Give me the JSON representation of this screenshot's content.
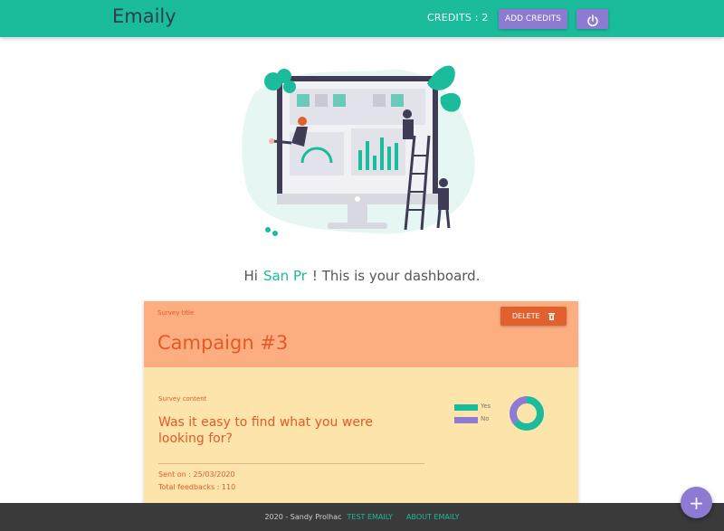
{
  "navbar": {
    "brand": "Emaily",
    "credits": "CREDITS : 2",
    "add_credits_label": "ADD CREDITS",
    "logout_icon": "power-icon"
  },
  "greeting": {
    "prefix": "Hi",
    "user_name": "San Pr",
    "suffix": "! This is your dashboard."
  },
  "survey": {
    "title_label": "Survey title",
    "title": "Campaign #3",
    "delete_label": "DELETE",
    "delete_icon": "trash-icon",
    "content_label": "Survey content",
    "question": "Was it easy to find what you were looking for?",
    "sent_on": "Sent on : 25/03/2020",
    "total_feedbacks": "Total feedbacks : 110",
    "chart_data": {
      "type": "pie",
      "categories": [
        "Yes",
        "No"
      ],
      "values": [
        0.64,
        0.36
      ],
      "colors": [
        "#1abc9c",
        "#8c7ad3"
      ]
    }
  },
  "footer": {
    "text": "2020 - Sandy Prolhac",
    "link_test": "TEST EMAILY",
    "link_about": "ABOUT EMAILY"
  },
  "fab": {
    "label": "+"
  },
  "colors": {
    "primary": "#1abc9c",
    "accent": "#8c7ad3",
    "card_header": "#fcae80",
    "card_body": "#fde4ab",
    "title_text": "#e45a27",
    "footer_bg": "#3a3a3a"
  }
}
